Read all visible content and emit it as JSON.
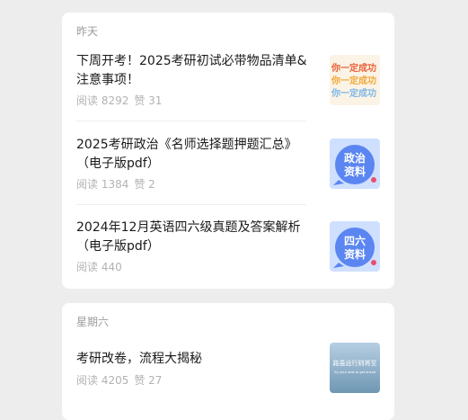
{
  "groups": [
    {
      "day": "昨天",
      "articles": [
        {
          "title": "下周开考！2025考研初试必带物品清单&注意事项！",
          "reads": "阅读 8292",
          "likes": "赞 31",
          "thumb_text": [
            "你一定成功",
            "你一定成功",
            "你一定成功"
          ],
          "thumb_colors": [
            "#e8643a",
            "#f2a93b",
            "#7fb8e6"
          ]
        },
        {
          "title": "2025考研政治《名师选择题押题汇总》（电子版pdf）",
          "reads": "阅读 1384",
          "likes": "赞 2",
          "thumb_text": [
            "政治",
            "资料"
          ]
        },
        {
          "title": "2024年12月英语四六级真题及答案解析（电子版pdf）",
          "reads": "阅读 440",
          "likes": "",
          "thumb_text": [
            "四六",
            "资料"
          ]
        }
      ]
    },
    {
      "day": "星期六",
      "articles": [
        {
          "title": "考研改卷，流程大揭秘",
          "reads": "阅读 4205",
          "likes": "赞 27",
          "thumb_text": [
            "路虽远行则将至",
            "Try your best to get ahead"
          ]
        }
      ]
    }
  ],
  "colors": {
    "background": "#ededed",
    "card": "#ffffff",
    "title_text": "#1a1a1a",
    "meta_text": "#b2b2b2",
    "thumb_blue": "#5b86f2",
    "thumb_sky": "#8fb5cf"
  }
}
